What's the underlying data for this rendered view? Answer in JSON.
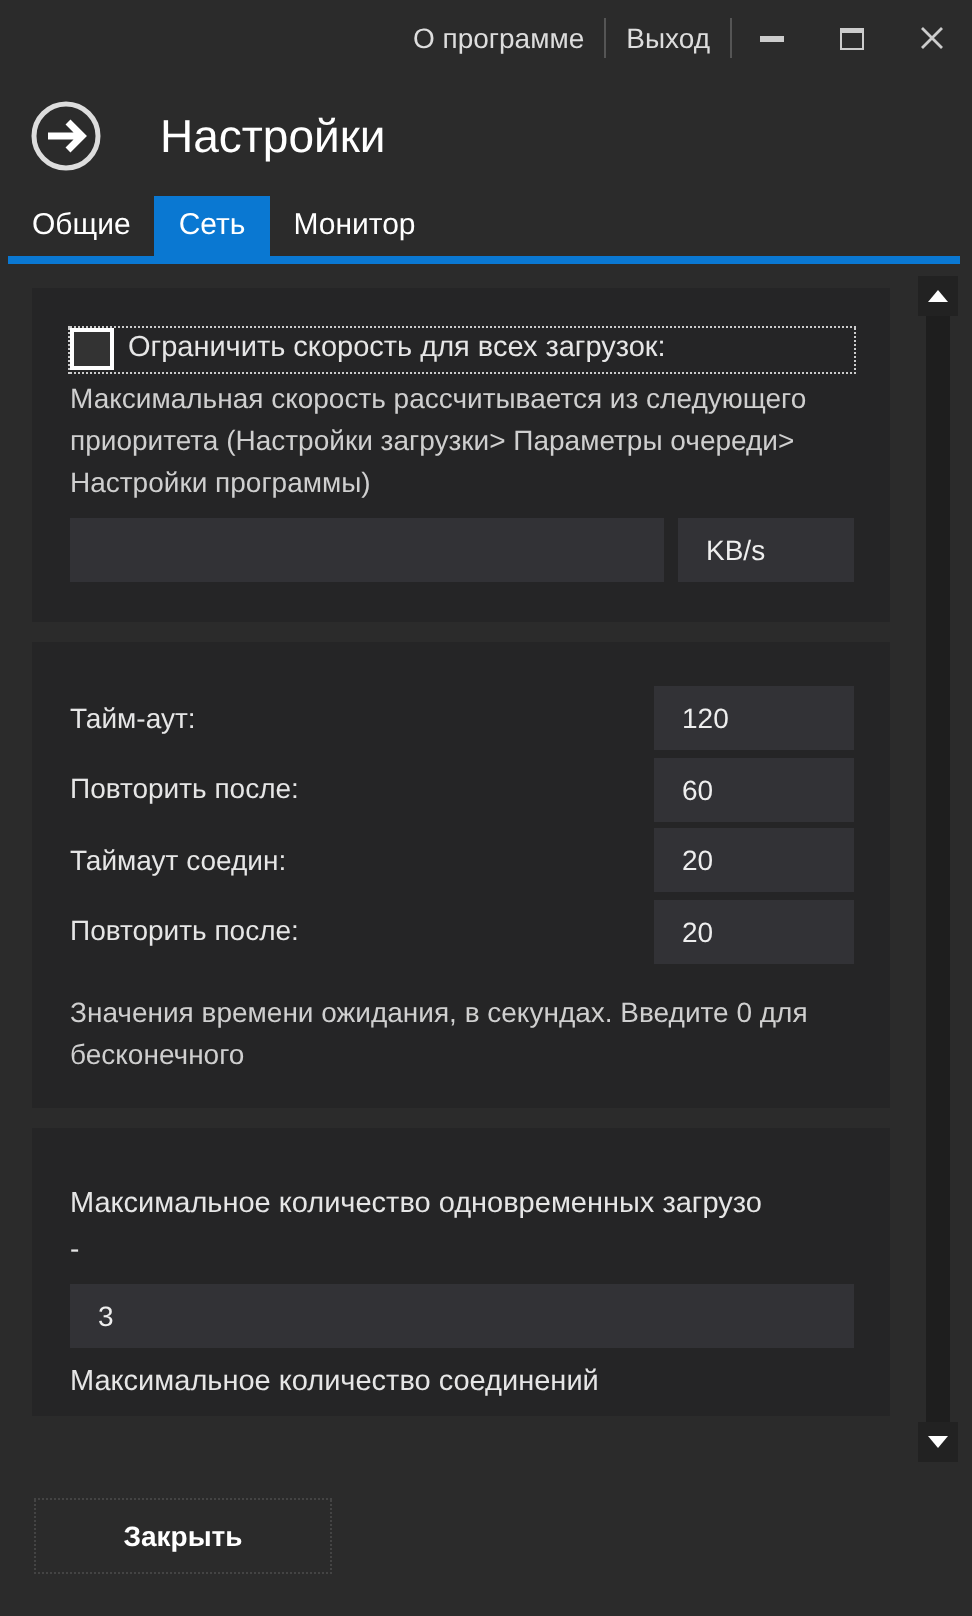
{
  "menu_links": [
    {
      "label": "О программе"
    },
    {
      "label": "Выход"
    }
  ],
  "title": "Настройки",
  "tabs": [
    {
      "label": "Общие",
      "selected": false
    },
    {
      "label": "Сеть",
      "selected": true
    },
    {
      "label": "Монитор",
      "selected": false
    }
  ],
  "speed": {
    "checkbox": {
      "label": "Ограничить скорость для всех загрузок:",
      "checked": false
    },
    "description": "Максимальная скорость рассчитывается из следующего приоритета (Настройки загрузки> Параметры очереди> Настройки программы)",
    "unit": "KB/s"
  },
  "timeouts": {
    "rows": [
      {
        "label": "Тайм-аут:",
        "value": "120"
      },
      {
        "label": "Повторить после:",
        "value": "60"
      },
      {
        "label": "Таймаут соедин:",
        "value": "20"
      },
      {
        "label": "Повторить после:",
        "value": "20"
      }
    ],
    "note": "Значения времени ожидания, в секундах. Введите 0 для бесконечного"
  },
  "downloads": {
    "label": "Максимальное количество одновременных загрузо",
    "suffix": "-",
    "value": "3",
    "label_2": "Максимальное количество соединений"
  },
  "close_button": "Закрыть"
}
